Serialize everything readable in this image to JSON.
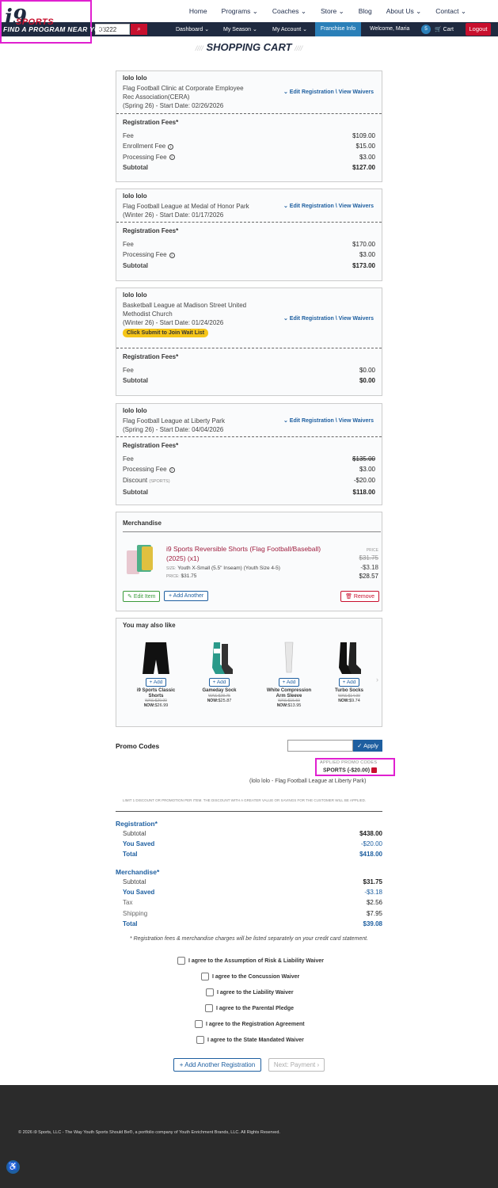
{
  "topnav": {
    "links": [
      "Home",
      "Programs",
      "Coaches",
      "Store",
      "Blog",
      "About Us",
      "Contact"
    ]
  },
  "logo": {
    "mark": "i9",
    "brand": "SPORTS",
    "tagline": "FIND A PROGRAM NEAR YOU"
  },
  "navbar": {
    "zip_value": "33222",
    "dashboard": "Dashboard",
    "my_season": "My Season",
    "my_account": "My Account",
    "franchise": "Franchise Info",
    "welcome": "Welcome, Maria",
    "cart_count": "5",
    "cart": "Cart",
    "logout": "Logout"
  },
  "page_title": "SHOPPING CART",
  "edit_link": "Edit Registration \\ View Waivers",
  "fees_heading": "Registration Fees*",
  "registrations": [
    {
      "name": "lolo lolo",
      "line1": "Flag Football Clinic at Corporate Employee",
      "line2": "Rec Association(CERA)",
      "line3": "(Spring 26) - Start Date: 02/26/2026",
      "fees": [
        {
          "label": "Fee",
          "value": "$109.00"
        },
        {
          "label": "Enrollment Fee",
          "value": "$15.00"
        },
        {
          "label": "Processing Fee",
          "value": "$3.00"
        },
        {
          "label": "Subtotal",
          "value": "$127.00"
        }
      ]
    },
    {
      "name": "lolo lolo",
      "line1": "Flag Football League at Medal of Honor Park",
      "line2": "(Winter 26) - Start Date: 01/17/2026",
      "fees": [
        {
          "label": "Fee",
          "value": "$170.00"
        },
        {
          "label": "Processing Fee",
          "value": "$3.00"
        },
        {
          "label": "Subtotal",
          "value": "$173.00"
        }
      ]
    },
    {
      "name": "lolo lolo",
      "line1": "Basketball League at Madison Street United",
      "line2": "Methodist Church",
      "line3": "(Winter 26) - Start Date: 01/24/2026",
      "wait_btn": "Click Submit to Join Wait List",
      "fees": [
        {
          "label": "Fee",
          "value": "$0.00"
        },
        {
          "label": "Subtotal",
          "value": "$0.00"
        }
      ]
    },
    {
      "name": "lolo lolo",
      "line1": "Flag Football League at Liberty Park",
      "line2": "(Spring 26) - Start Date: 04/04/2026",
      "fees": [
        {
          "label": "Fee",
          "value": "$135.00"
        },
        {
          "label": "Processing Fee",
          "value": "$3.00"
        },
        {
          "label": "Discount",
          "tag": "(SPORTS)",
          "value": "-$20.00"
        },
        {
          "label": "Subtotal",
          "value": "$118.00"
        }
      ]
    }
  ],
  "merchandise": {
    "heading": "Merchandise",
    "item_name": "i9 Sports Reversible Shorts (Flag Football/Baseball) (2025) (x1)",
    "size_label": "SIZE:",
    "size": "Youth X-Small (5.5\" Inseam) (Youth Size 4-5)",
    "price_label": "PRICE:",
    "price": "$31.75",
    "col_label": "PRICE",
    "was": "$31.75",
    "discount": "-$3.18",
    "now": "$28.57",
    "edit": "Edit Item",
    "add_another": "Add Another",
    "remove": "Remove"
  },
  "you_may_also_like": {
    "heading": "You may also like",
    "add": "Add",
    "was_label": "WAS:",
    "now_label": "NOW:",
    "products": [
      {
        "name": "i9 Sports Classic Shorts",
        "was": "$29.99",
        "now": "$26.99"
      },
      {
        "name": "Gameday Sock",
        "was": "$28.75",
        "now": "$25.87"
      },
      {
        "name": "White Compression Arm Sleeve",
        "was": "$15.50",
        "now": "$13.95"
      },
      {
        "name": "Turbo Socks",
        "was": "$14.99",
        "now": "$9.74"
      }
    ]
  },
  "promo": {
    "label": "Promo Codes",
    "input_value": "",
    "apply": "Apply",
    "applied_label": "APPLIED PROMO CODES",
    "applied_code": "SPORTS (-$20.00)",
    "applied_for": "(lolo lolo - Flag Football League at Liberty Park)",
    "limit_note": "LIMIT 1 DISCOUNT OR PROMOTION PER ITEM. THE DISCOUNT WITH A GREATER VALUE OR SAVINGS FOR THE CUSTOMER WILL BE APPLIED."
  },
  "summary": {
    "registration_heading": "Registration*",
    "reg": [
      {
        "label": "Subtotal",
        "value": "$438.00"
      },
      {
        "label": "You Saved",
        "value": "-$20.00"
      },
      {
        "label": "Total",
        "value": "$418.00"
      }
    ],
    "merch_heading": "Merchandise*",
    "merch": [
      {
        "label": "Subtotal",
        "value": "$31.75"
      },
      {
        "label": "You Saved",
        "value": "-$3.18"
      },
      {
        "label": "Tax",
        "value": "$2.56"
      },
      {
        "label": "Shipping",
        "value": "$7.95"
      },
      {
        "label": "Total",
        "value": "$39.08"
      }
    ],
    "note": "* Registration fees & merchandise charges will be listed separately on your credit card statement."
  },
  "agreements": [
    "I agree to the Assumption of Risk & Liability Waiver",
    "I agree to the Concussion Waiver",
    "I agree to the Liability Waiver",
    "I agree to the Parental Pledge",
    "I agree to the Registration Agreement",
    "I agree to the State Mandated Waiver"
  ],
  "actions": {
    "add_registration": "Add Another Registration",
    "next": "Next: Payment"
  },
  "footer": {
    "copyright": "© 2026 i9 Sports, LLC - The Way Youth Sports Should Be®, a portfolio company of Youth Enrichment Brands, LLC. All Rights Reserved."
  },
  "colors": {
    "navy": "#1f2a40",
    "red": "#c8102e",
    "blue": "#1e5fa0",
    "highlight": "#e020d0"
  }
}
